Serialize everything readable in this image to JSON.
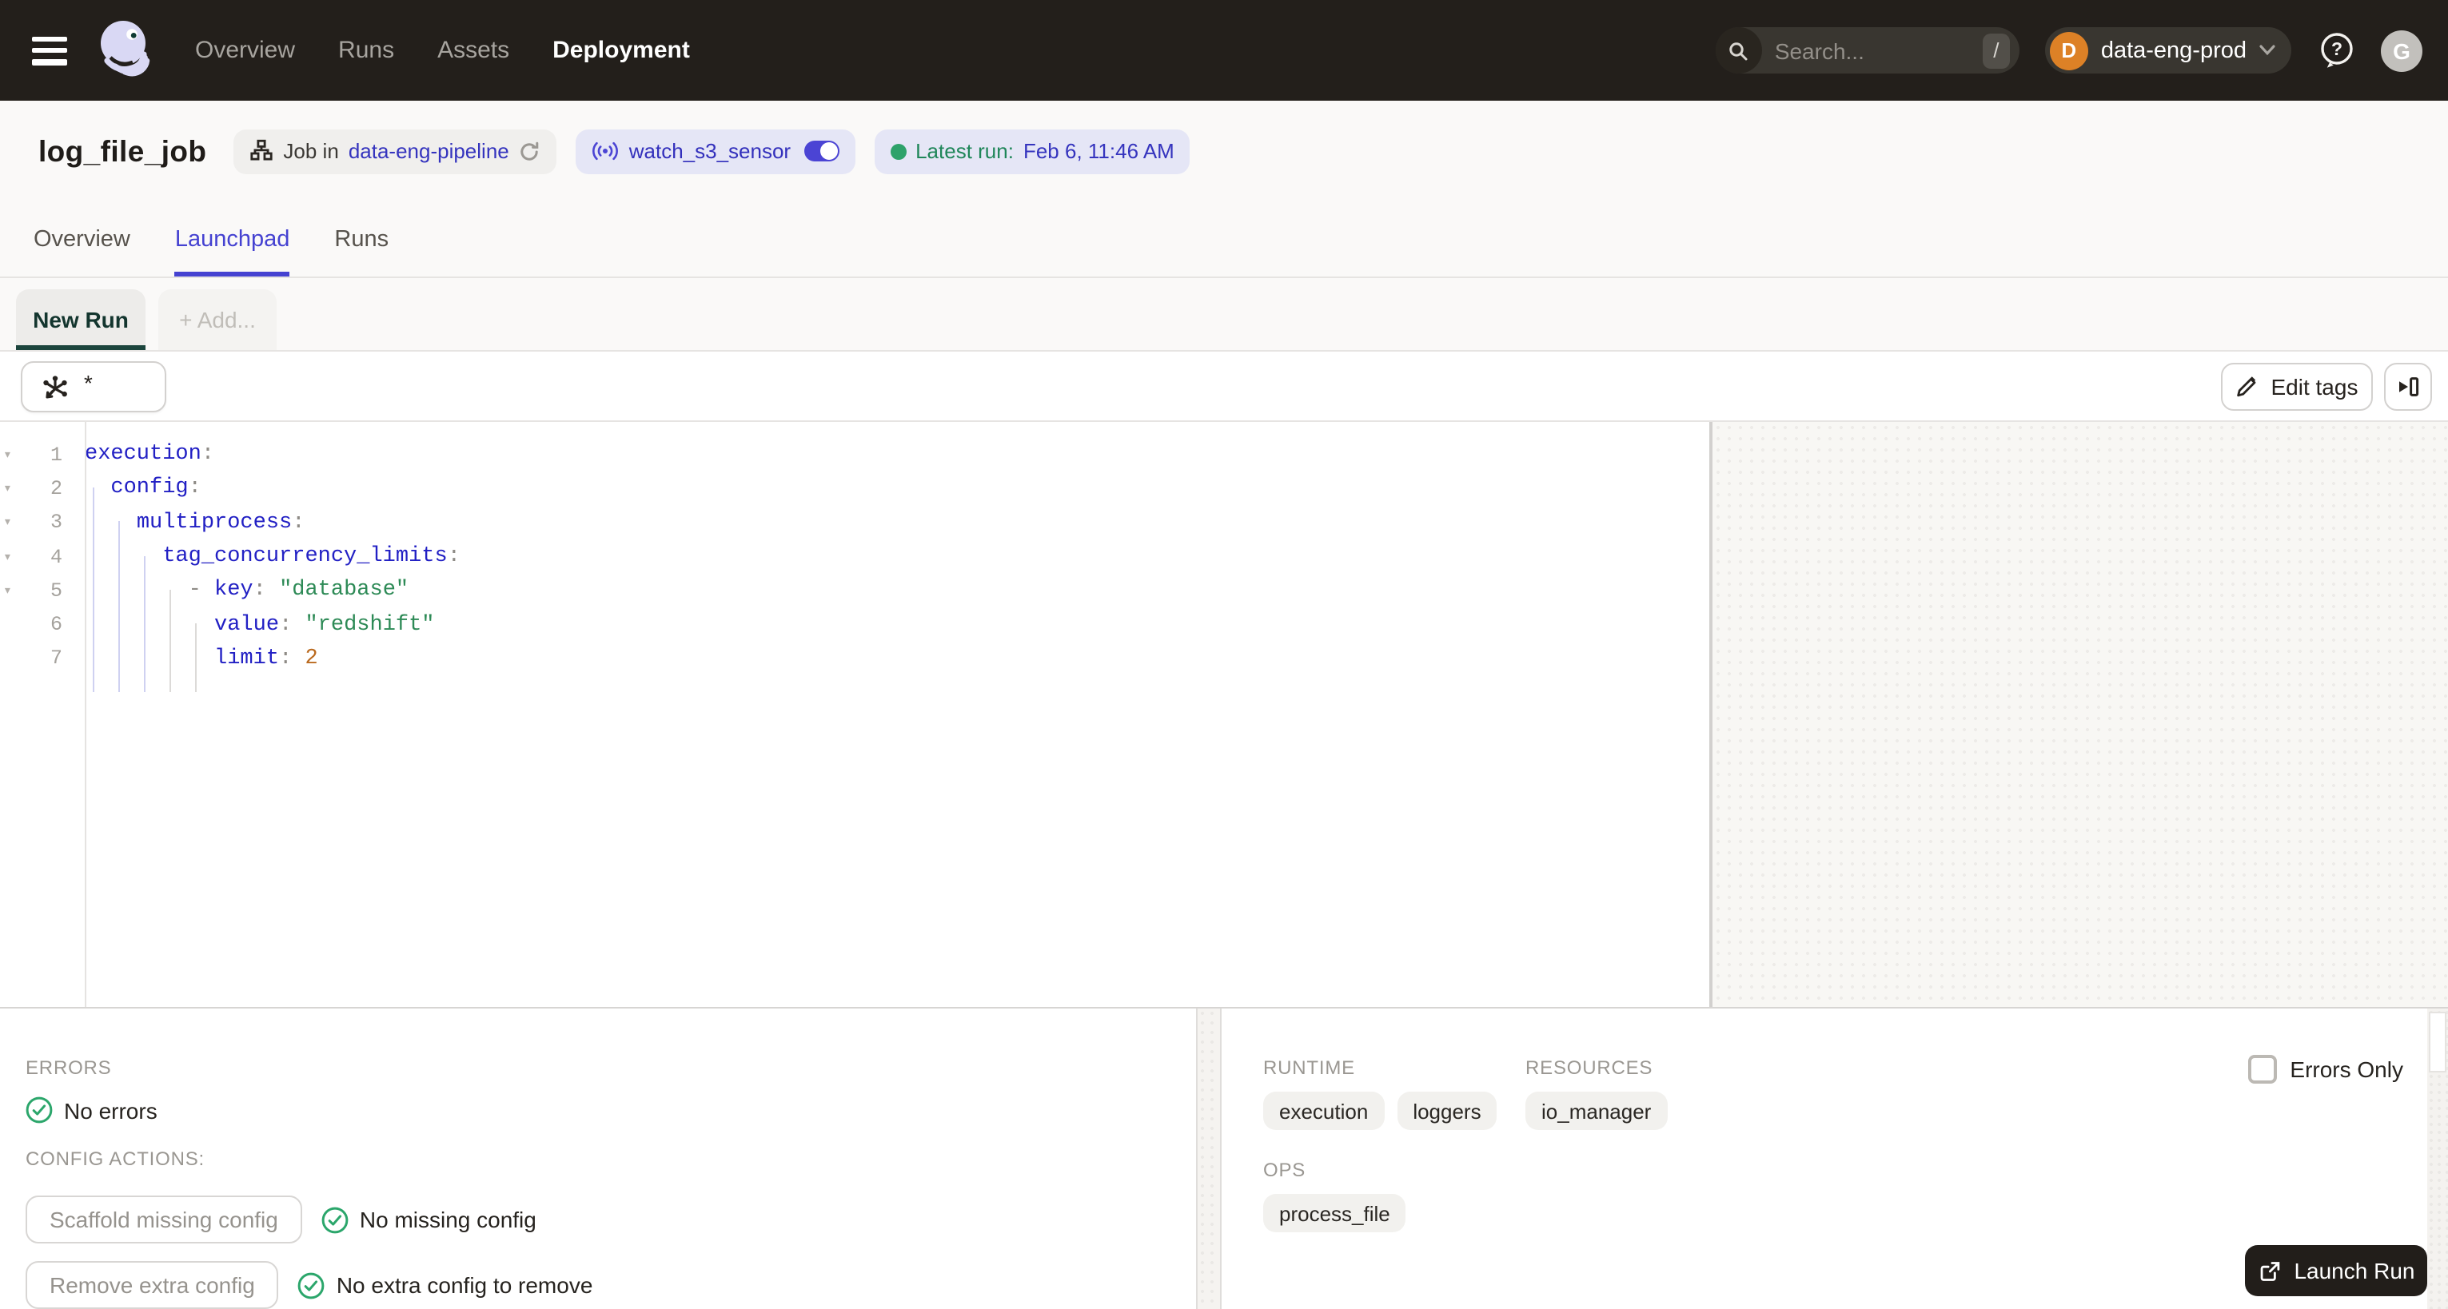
{
  "header": {
    "nav": {
      "items": [
        {
          "label": "Overview"
        },
        {
          "label": "Runs"
        },
        {
          "label": "Assets"
        },
        {
          "label": "Deployment"
        }
      ]
    },
    "search": {
      "placeholder": "Search...",
      "shortcut": "/"
    },
    "deployment_switcher": {
      "initial": "D",
      "label": "data-eng-prod"
    },
    "user_initial": "G"
  },
  "title_bar": {
    "title": "log_file_job",
    "job_tag": {
      "prefix": "Job in",
      "repo_link": "data-eng-pipeline"
    },
    "sensor_tag": {
      "label": "watch_s3_sensor"
    },
    "latest_run_tag": {
      "label": "Latest run:",
      "value": "Feb 6, 11:46 AM"
    }
  },
  "tabs": {
    "items": [
      {
        "label": "Overview"
      },
      {
        "label": "Launchpad"
      },
      {
        "label": "Runs"
      }
    ],
    "active": "Launchpad"
  },
  "run_tabs": {
    "new_run": "New Run",
    "add": "+ Add..."
  },
  "toolbar": {
    "op_selector": "*",
    "edit_tags": "Edit tags"
  },
  "editor": {
    "lines": [
      {
        "num": "1",
        "fold": "▾",
        "indent": "",
        "bullet": "",
        "key": "execution",
        "colon": ":",
        "str": "",
        "numv": ""
      },
      {
        "num": "2",
        "fold": "▾",
        "indent": "  ",
        "bullet": "",
        "key": "config",
        "colon": ":",
        "str": "",
        "numv": ""
      },
      {
        "num": "3",
        "fold": "▾",
        "indent": "    ",
        "bullet": "",
        "key": "multiprocess",
        "colon": ":",
        "str": "",
        "numv": ""
      },
      {
        "num": "4",
        "fold": "▾",
        "indent": "      ",
        "bullet": "",
        "key": "tag_concurrency_limits",
        "colon": ":",
        "str": "",
        "numv": ""
      },
      {
        "num": "5",
        "fold": "▾",
        "indent": "        ",
        "bullet": "- ",
        "key": "key",
        "colon": ":",
        "str": " \"database\"",
        "numv": ""
      },
      {
        "num": "6",
        "fold": "",
        "indent": "          ",
        "bullet": "",
        "key": "value",
        "colon": ":",
        "str": " \"redshift\"",
        "numv": ""
      },
      {
        "num": "7",
        "fold": "",
        "indent": "          ",
        "bullet": "",
        "key": "limit",
        "colon": ":",
        "str": "",
        "numv": " 2"
      }
    ]
  },
  "panels": {
    "errors": {
      "heading": "ERRORS",
      "no_errors": "No errors",
      "config_actions_heading": "CONFIG ACTIONS:",
      "scaffold_button": "Scaffold missing config",
      "scaffold_status": "No missing config",
      "remove_button": "Remove extra config",
      "remove_status": "No extra config to remove"
    },
    "config_schema": {
      "errors_only_label": "Errors Only",
      "runtime_heading": "RUNTIME",
      "runtime_tags": [
        "execution",
        "loggers"
      ],
      "resources_heading": "RESOURCES",
      "resources_tags": [
        "io_manager"
      ],
      "ops_heading": "OPS",
      "ops_tags": [
        "process_file"
      ],
      "launch_button": "Launch Run"
    }
  },
  "colors": {
    "header_bg": "#231F1B",
    "accent_indigo": "#4542D1",
    "link_indigo": "#3534BE",
    "success_green": "#2BA66B",
    "env_avatar_orange": "#DD8126",
    "launch_button_bg": "#221E1A",
    "code_key": "#2220C4",
    "code_string": "#2D8A56",
    "code_number": "#BA6A1F"
  }
}
